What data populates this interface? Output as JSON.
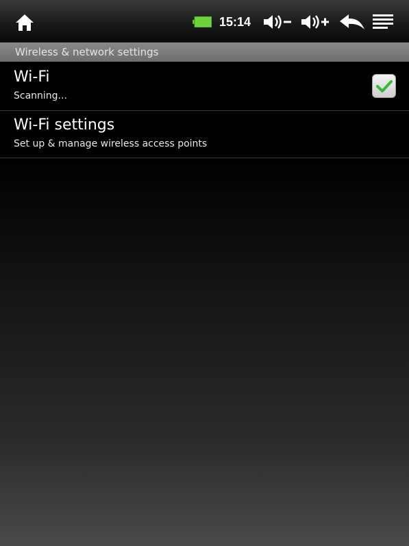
{
  "status_bar": {
    "time": "15:14",
    "icons": [
      "home-icon",
      "battery-icon",
      "volume-down-icon",
      "volume-up-icon",
      "back-icon",
      "menu-icon"
    ],
    "battery_color": "#6fd13b"
  },
  "category": {
    "title": "Wireless & network settings"
  },
  "items": [
    {
      "title": "Wi-Fi",
      "summary": "Scanning...",
      "checked": true
    },
    {
      "title": "Wi-Fi settings",
      "summary": "Set up & manage wireless access points"
    }
  ],
  "colors": {
    "check_green": "#3db53d",
    "header_bg": "#7a7a7a"
  }
}
